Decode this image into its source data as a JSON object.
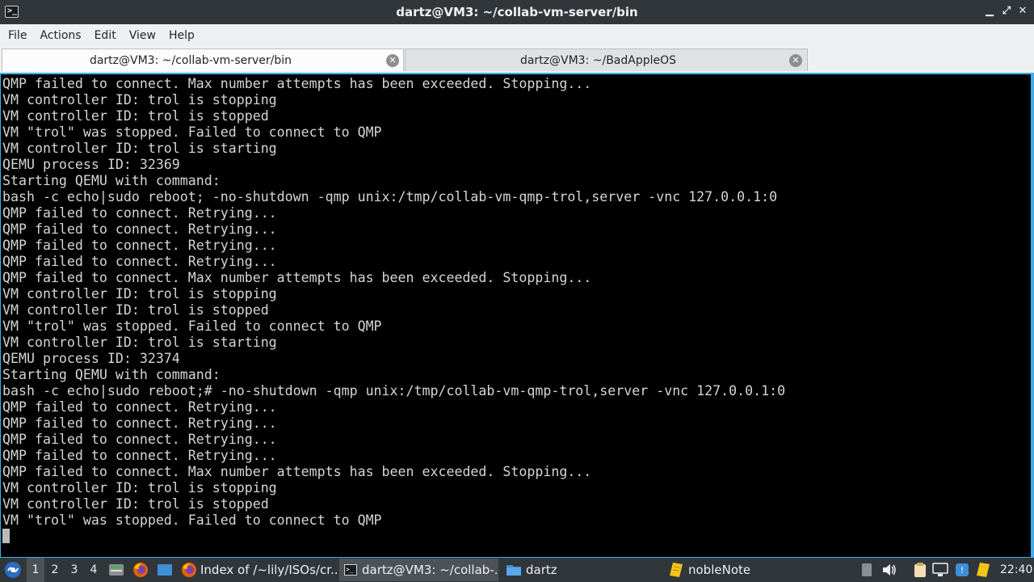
{
  "window": {
    "title": "dartz@VM3: ~/collab-vm-server/bin",
    "minimize_glyph": "▁",
    "maximize_glyph": "⤢",
    "close_glyph": "✕",
    "app_icon_glyph": ">_"
  },
  "menu": {
    "items": [
      "File",
      "Actions",
      "Edit",
      "View",
      "Help"
    ]
  },
  "tabs": [
    {
      "label": "dartz@VM3: ~/collab-vm-server/bin",
      "active": true
    },
    {
      "label": "dartz@VM3: ~/BadAppleOS",
      "active": false
    }
  ],
  "terminal": {
    "lines": [
      "QMP failed to connect. Max number attempts has been exceeded. Stopping...",
      "VM controller ID: trol is stopping",
      "VM controller ID: trol is stopped",
      "VM \"trol\" was stopped. Failed to connect to QMP",
      "VM controller ID: trol is starting",
      "QEMU process ID: 32369",
      "Starting QEMU with command:",
      "bash -c echo|sudo reboot; -no-shutdown -qmp unix:/tmp/collab-vm-qmp-trol,server -vnc 127.0.0.1:0",
      "QMP failed to connect. Retrying...",
      "QMP failed to connect. Retrying...",
      "QMP failed to connect. Retrying...",
      "QMP failed to connect. Retrying...",
      "QMP failed to connect. Max number attempts has been exceeded. Stopping...",
      "VM controller ID: trol is stopping",
      "VM controller ID: trol is stopped",
      "VM \"trol\" was stopped. Failed to connect to QMP",
      "VM controller ID: trol is starting",
      "QEMU process ID: 32374",
      "Starting QEMU with command:",
      "bash -c echo|sudo reboot;# -no-shutdown -qmp unix:/tmp/collab-vm-qmp-trol,server -vnc 127.0.0.1:0",
      "QMP failed to connect. Retrying...",
      "QMP failed to connect. Retrying...",
      "QMP failed to connect. Retrying...",
      "QMP failed to connect. Retrying...",
      "QMP failed to connect. Max number attempts has been exceeded. Stopping...",
      "VM controller ID: trol is stopping",
      "VM controller ID: trol is stopped",
      "VM \"trol\" was stopped. Failed to connect to QMP"
    ]
  },
  "taskbar": {
    "desktops": [
      "1",
      "2",
      "3",
      "4"
    ],
    "active_desktop": "1",
    "tasks": [
      {
        "label": "Index of /~lily/ISOs/cr...",
        "icon": "firefox-icon"
      },
      {
        "label": "dartz@VM3: ~/collab-...",
        "icon": "terminal-icon"
      },
      {
        "label": "dartz",
        "icon": "folder-icon"
      },
      {
        "label": "nobleNote",
        "icon": "note-icon"
      }
    ],
    "clock": "22:40"
  },
  "colors": {
    "titlebar": "#31363b",
    "terminal_bg": "#000000",
    "terminal_fg": "#d3d7cf",
    "focus_accent": "#3daee9",
    "taskbar": "#31363b"
  }
}
